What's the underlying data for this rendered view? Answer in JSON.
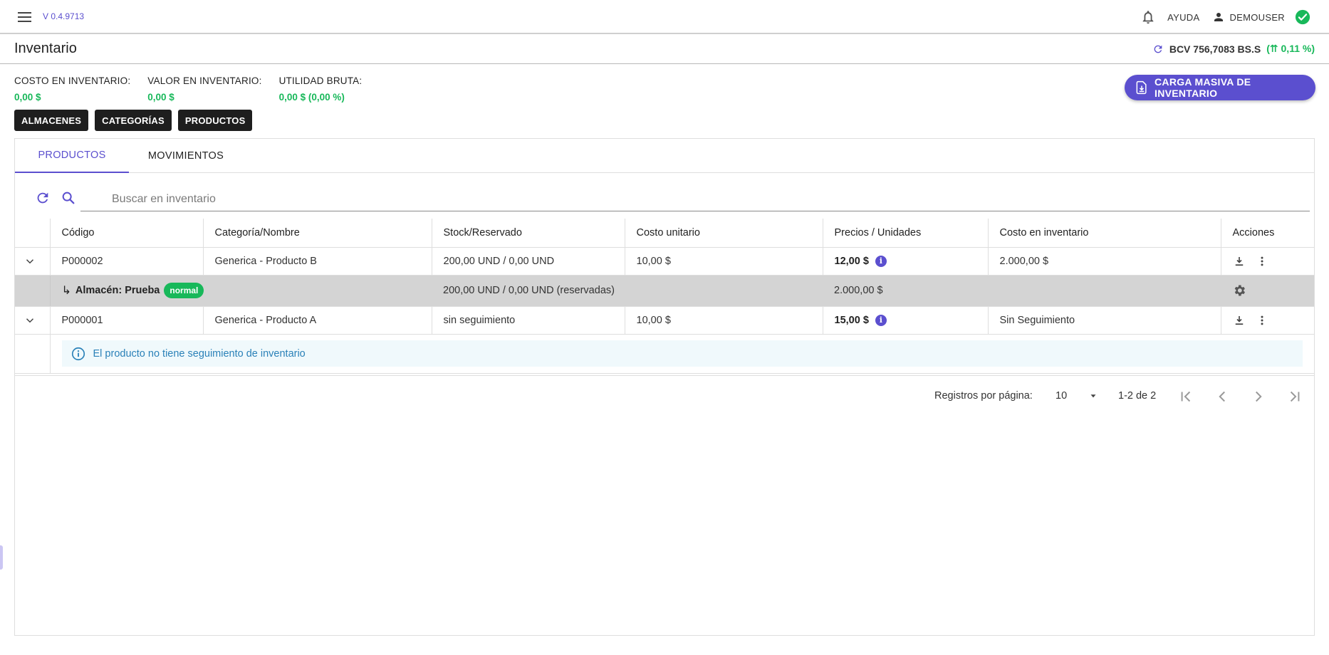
{
  "header": {
    "version": "V 0.4.9713",
    "help_label": "AYUDA",
    "user_name": "DEMOUSER"
  },
  "page": {
    "title": "Inventario",
    "rate": {
      "text": "BCV 756,7083 BS.S",
      "change": "(⇈ 0,11 %)"
    }
  },
  "stats": [
    {
      "label": "COSTO EN INVENTARIO:",
      "value": "0,00 $"
    },
    {
      "label": "VALOR EN INVENTARIO:",
      "value": "0,00 $"
    },
    {
      "label": "UTILIDAD BRUTA:",
      "value": "0,00 $ (0,00 %)"
    }
  ],
  "bulk_button": "CARGA MASIVA DE INVENTARIO",
  "chips": [
    "ALMACENES",
    "CATEGORÍAS",
    "PRODUCTOS"
  ],
  "tabs": [
    "PRODUCTOS",
    "MOVIMIENTOS"
  ],
  "search": {
    "placeholder": "Buscar en inventario"
  },
  "table": {
    "headers": [
      "Código",
      "Categoría/Nombre",
      "Stock/Reservado",
      "Costo unitario",
      "Precios / Unidades",
      "Costo en inventario",
      "Acciones"
    ],
    "rows": [
      {
        "code": "P000002",
        "name": "Generica - Producto B",
        "stock": "200,00 UND / 0,00 UND",
        "unit_cost": "10,00 $",
        "price": "12,00 $",
        "inv_cost": "2.000,00 $"
      },
      {
        "code": "P000001",
        "name": "Generica - Producto A",
        "stock": "sin seguimiento",
        "unit_cost": "10,00 $",
        "price": "15,00 $",
        "inv_cost": "Sin Seguimiento"
      }
    ],
    "sub_row": {
      "warehouse": "Almacén: Prueba",
      "badge": "normal",
      "stock": "200,00 UND / 0,00 UND (reservadas)",
      "value": "2.000,00 $"
    },
    "alert": "El producto no tiene seguimiento de inventario"
  },
  "pagination": {
    "label": "Registros por página:",
    "page_size": "10",
    "range": "1-2 de 2"
  },
  "colors": {
    "accent": "#5b4fcf",
    "success": "#18b85a",
    "info": "#2a81b8"
  }
}
